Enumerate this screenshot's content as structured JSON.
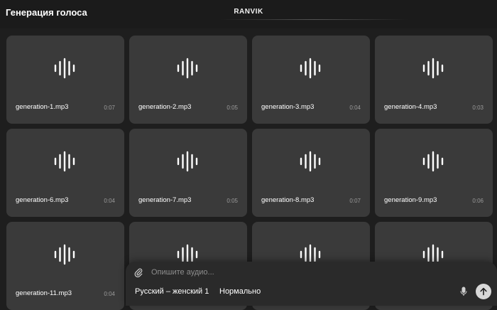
{
  "header": {
    "title": "Генерация голоса",
    "brand": "RANVIK"
  },
  "generations": [
    {
      "name": "generation-1.mp3",
      "duration": "0:07"
    },
    {
      "name": "generation-2.mp3",
      "duration": "0:05"
    },
    {
      "name": "generation-3.mp3",
      "duration": "0:04"
    },
    {
      "name": "generation-4.mp3",
      "duration": "0:03"
    },
    {
      "name": "generation-6.mp3",
      "duration": "0:04"
    },
    {
      "name": "generation-7.mp3",
      "duration": "0:05"
    },
    {
      "name": "generation-8.mp3",
      "duration": "0:07"
    },
    {
      "name": "generation-9.mp3",
      "duration": "0:06"
    },
    {
      "name": "generation-11.mp3",
      "duration": "0:04"
    },
    {
      "name": "",
      "duration": ""
    },
    {
      "name": "",
      "duration": ""
    },
    {
      "name": "",
      "duration": ""
    }
  ],
  "composer": {
    "placeholder": "Опишите аудио...",
    "voice": "Русский – женский 1",
    "speed": "Нормально"
  },
  "icons": {
    "card": "waveform-icon",
    "attach": "paperclip-icon",
    "mic": "microphone-icon",
    "send": "arrow-up-icon"
  }
}
